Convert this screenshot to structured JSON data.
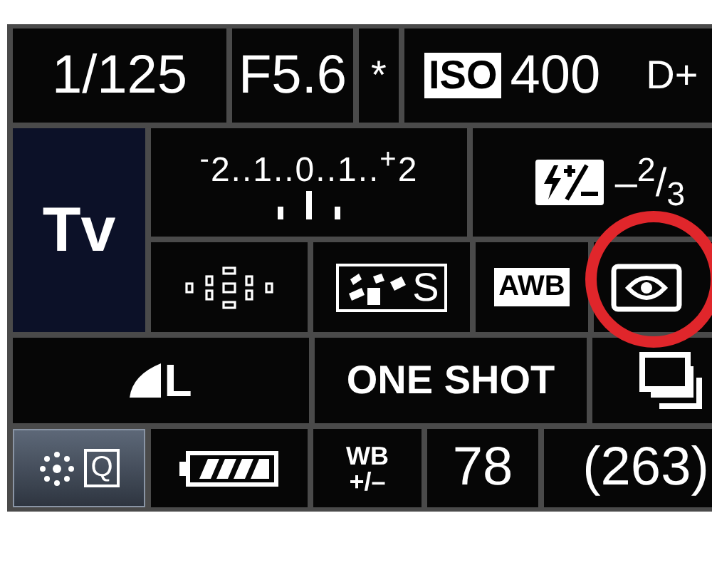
{
  "top_bar": {
    "shutter": "1/125",
    "aperture": "F5.6",
    "flash_exposure_lock": "*",
    "iso_label": "ISO",
    "iso": "400",
    "highlight_tone": "D+"
  },
  "mode": {
    "label": "Tv"
  },
  "exposure_scale": {
    "scale": "$^{-}$2..1..0..1..$^{+}$2",
    "level": 0.5
  },
  "flash_compensation": {
    "value": "–$^{2}$/$_{3}$"
  },
  "picture_style": {
    "label": "S"
  },
  "white_balance": {
    "label": "AWB"
  },
  "metering": {
    "circled": true
  },
  "quality": {
    "label": "L"
  },
  "af_mode": {
    "label": "ONE SHOT"
  },
  "quick_control": {
    "label": "Q",
    "selected": true
  },
  "wb_shift": {
    "top": "WB",
    "bottom": "+/–"
  },
  "max_burst": "78",
  "shots_remaining": "(263)"
}
